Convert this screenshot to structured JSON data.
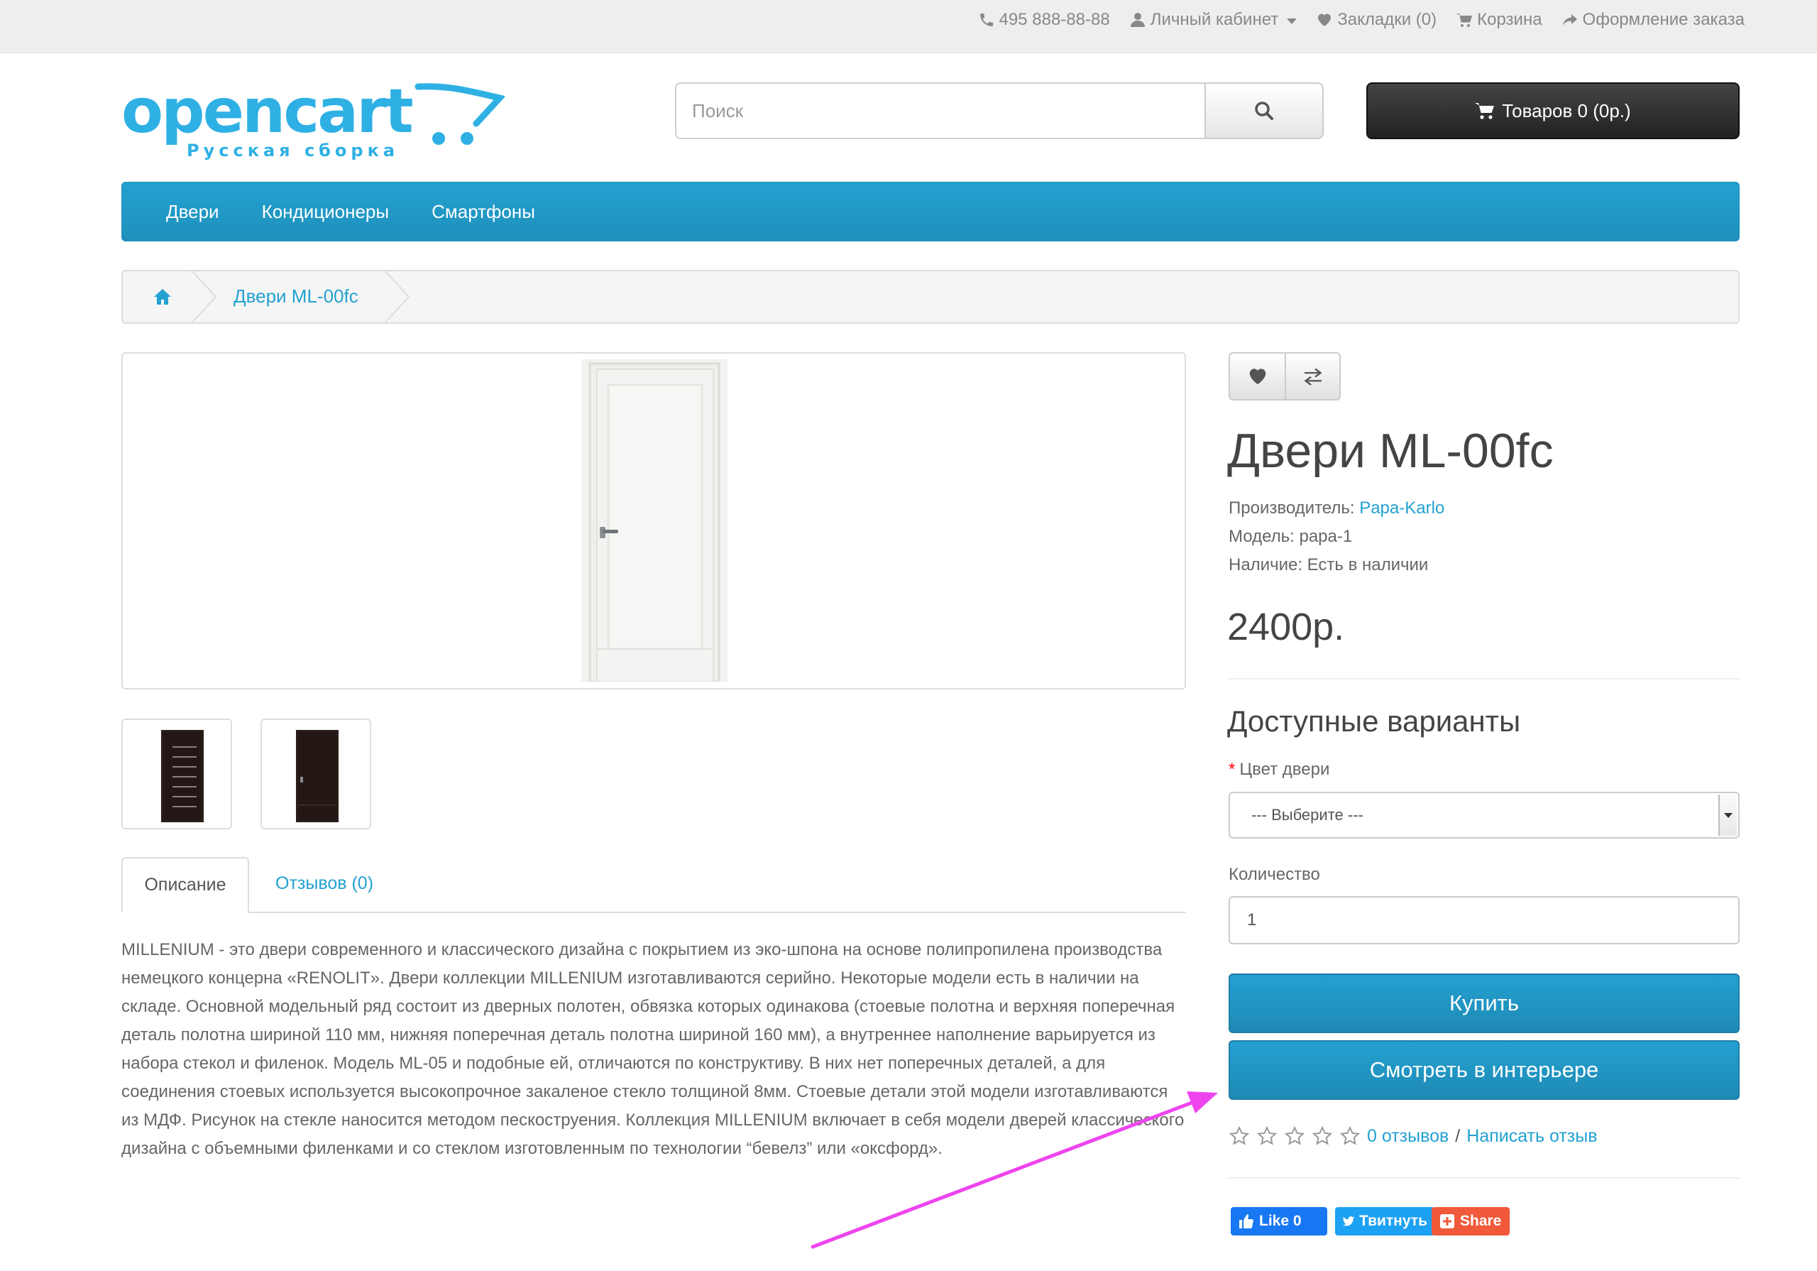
{
  "topbar": {
    "phone": "495 888-88-88",
    "account": "Личный кабинет",
    "wishlist": "Закладки (0)",
    "cart": "Корзина",
    "checkout": "Оформление заказа"
  },
  "logo": {
    "name": "opencart",
    "tagline": "Русская сборка"
  },
  "search": {
    "placeholder": "Поиск",
    "value": ""
  },
  "cart_button": {
    "label": "Товаров 0 (0р.)"
  },
  "menu": {
    "items": [
      "Двери",
      "Кондиционеры",
      "Смартфоны"
    ]
  },
  "breadcrumb": {
    "current": "Двери ML-00fc"
  },
  "product": {
    "title": "Двери ML-00fc",
    "manufacturer_label": "Производитель:",
    "manufacturer": "Papa-Karlo",
    "model": "Модель: papa-1",
    "availability": "Наличие: Есть в наличии",
    "price": "2400р."
  },
  "options": {
    "title": "Доступные варианты",
    "required_mark": "*",
    "color_label": "Цвет двери",
    "color_selected": "--- Выберите ---",
    "qty_label": "Количество",
    "qty_value": "1"
  },
  "buttons": {
    "buy": "Купить",
    "interior": "Смотреть в интерьере"
  },
  "rating": {
    "reviews_link": "0 отзывов",
    "separator": "/",
    "write_link": "Написать отзыв"
  },
  "share": {
    "like": "Like 0",
    "tweet": "Твитнуть",
    "share": "Share"
  },
  "tabs": [
    "Описание",
    "Отзывов (0)"
  ],
  "description": "MILLENIUM - это двери современного и классического дизайна с покрытием из эко-шпона на основе полипропилена производства немецкого концерна «RENOLIT». Двери коллекции MILLENIUM изготавливаются серийно. Некоторые модели есть в наличии на складе. Основной модельный ряд состоит из дверных полотен, обвязка которых одинакова (стоевые полотна и верхняя поперечная деталь полотна шириной 110 мм, нижняя поперечная деталь полотна шириной 160 мм), а внутреннее наполнение варьируется из набора стекол и филенок. Модель ML-05 и подобные ей, отличаются по конструктиву. В них нет поперечных деталей, а для соединения стоевых используется высокопрочное закаленое стекло толщиной 8мм. Стоевые детали этой модели изготавливаются из МДФ. Рисунок на стекле наносится методом пескоструения. Коллекция MILLENIUM включает в себя модели дверей классического дизайна с объемными филенками и со стеклом изготовленным по технологии “бевелз” или «оксфорд».",
  "colors": {
    "accent": "#23a1d1",
    "annotation": "#ee44ee"
  }
}
